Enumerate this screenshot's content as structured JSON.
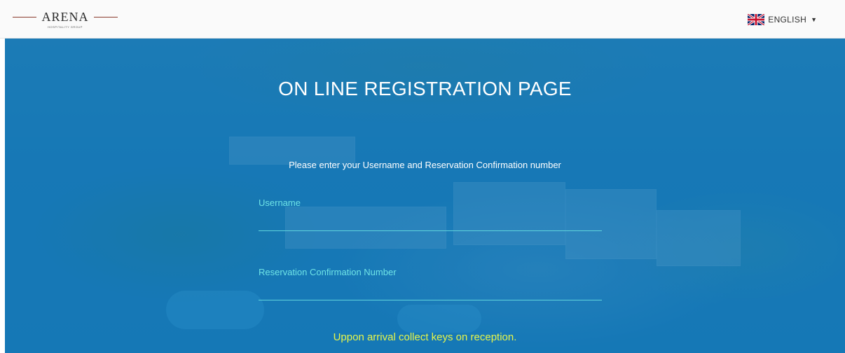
{
  "header": {
    "logo": {
      "wordmark": "ARENA",
      "tagline": "HOSPITALITY GROUP"
    },
    "language": {
      "flag_icon": "uk-flag-icon",
      "label": "ENGLISH",
      "caret_icon": "caret-down-icon"
    }
  },
  "main": {
    "title": "ON LINE REGISTRATION PAGE",
    "instructions": "Please enter your Username and Reservation Confirmation number",
    "fields": {
      "username": {
        "label": "Username",
        "value": ""
      },
      "reservation": {
        "label": "Reservation Confirmation Number",
        "value": ""
      }
    },
    "note": "Uppon arrival collect keys on reception."
  },
  "colors": {
    "overlay_blue": "#1c78ae",
    "field_label": "#6ee3e6",
    "note_text": "#e6f54a",
    "title_text": "#ffffff"
  }
}
